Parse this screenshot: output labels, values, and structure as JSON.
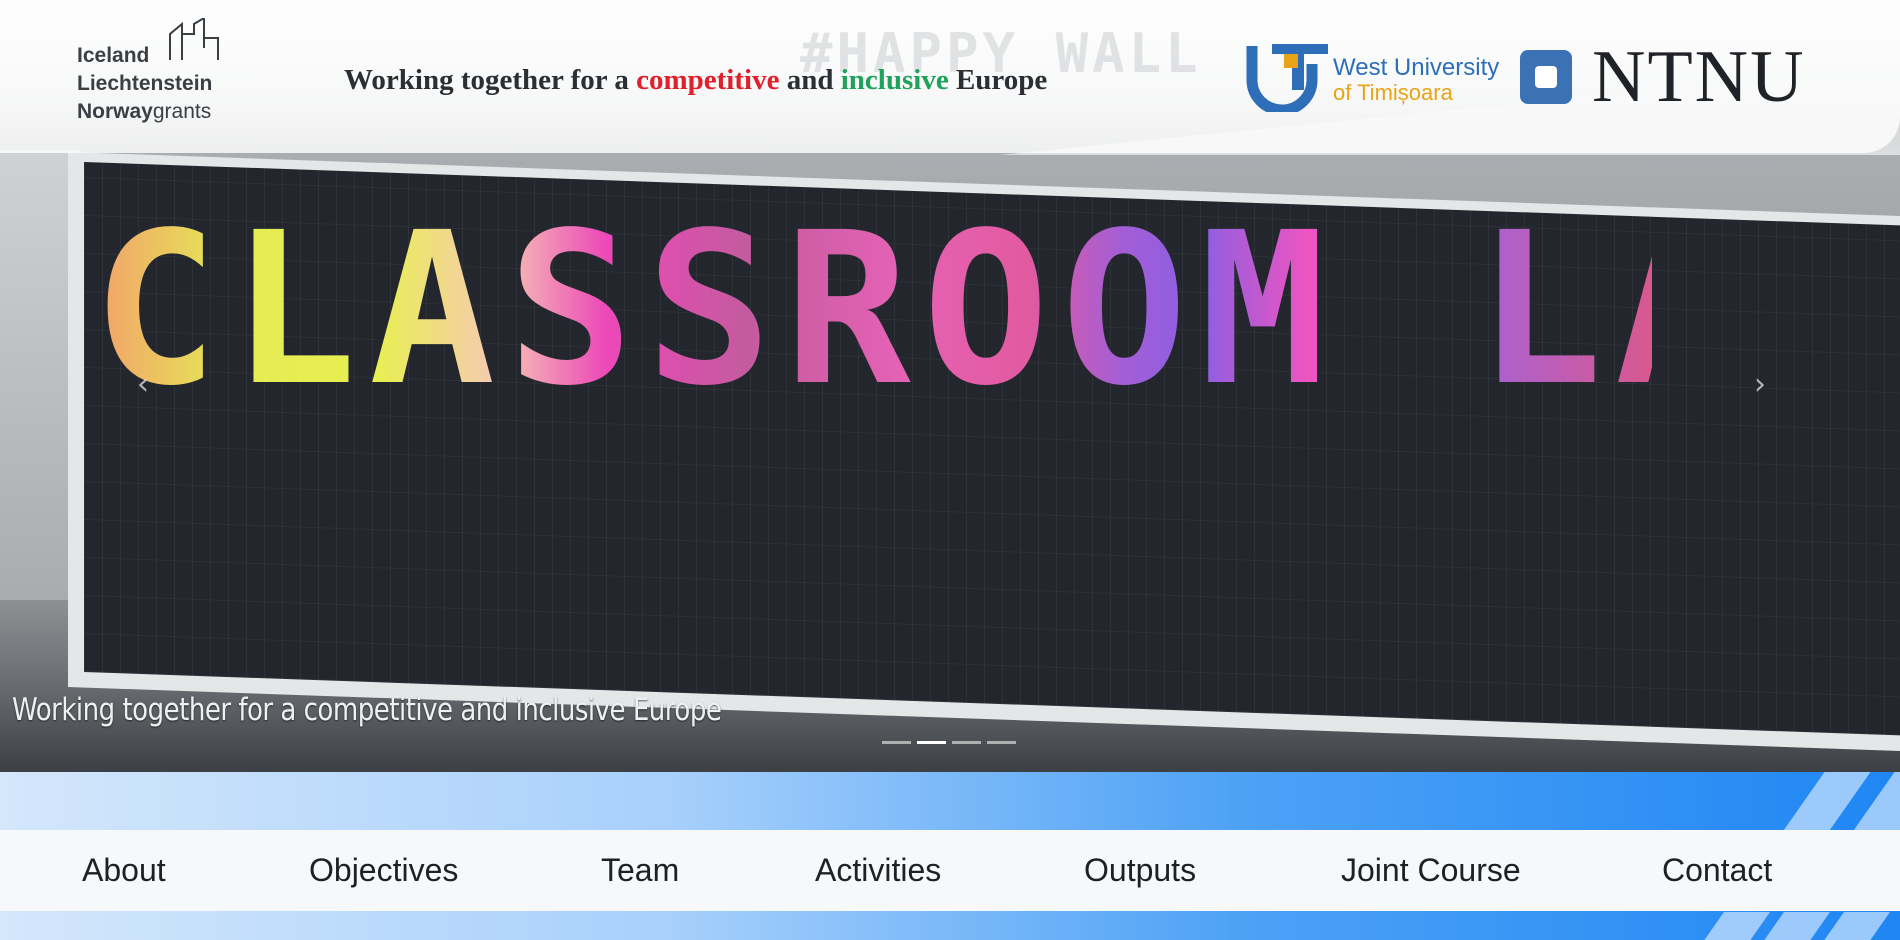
{
  "header": {
    "grants_logo": {
      "line1": "Iceland",
      "line2": "Liechtenstein",
      "line3_bold": "Norway",
      "line3_light": "grants"
    },
    "tagline": {
      "part1": "Working together for a ",
      "competitive": "competitive",
      "part2": " and ",
      "inclusive": "inclusive",
      "part3": " Europe"
    },
    "wut_logo": {
      "line1": "West University",
      "line2": "of Timișoara"
    },
    "ntnu_logo": {
      "text": "NTNU"
    }
  },
  "hero": {
    "wall_text": "CLASSROOM LAB",
    "wall_sign": "#HAPPY WALL",
    "caption": "Working together for a competitive and inclusive Europe",
    "prev_icon": "chevron-left-icon",
    "next_icon": "chevron-right-icon",
    "prev_glyph": "‹",
    "next_glyph": "›",
    "slide_count": 4,
    "active_slide": 2
  },
  "nav": {
    "items": [
      "About",
      "Objectives",
      "Team",
      "Activities",
      "Outputs",
      "Joint Course",
      "Contact"
    ]
  },
  "colors": {
    "accent_red": "#e0202a",
    "accent_green": "#1fa35a",
    "wut_blue": "#2e6eb8",
    "wut_gold": "#e8a317",
    "ntnu_blue": "#3b72b6",
    "band_blue": "#1f86f3"
  }
}
